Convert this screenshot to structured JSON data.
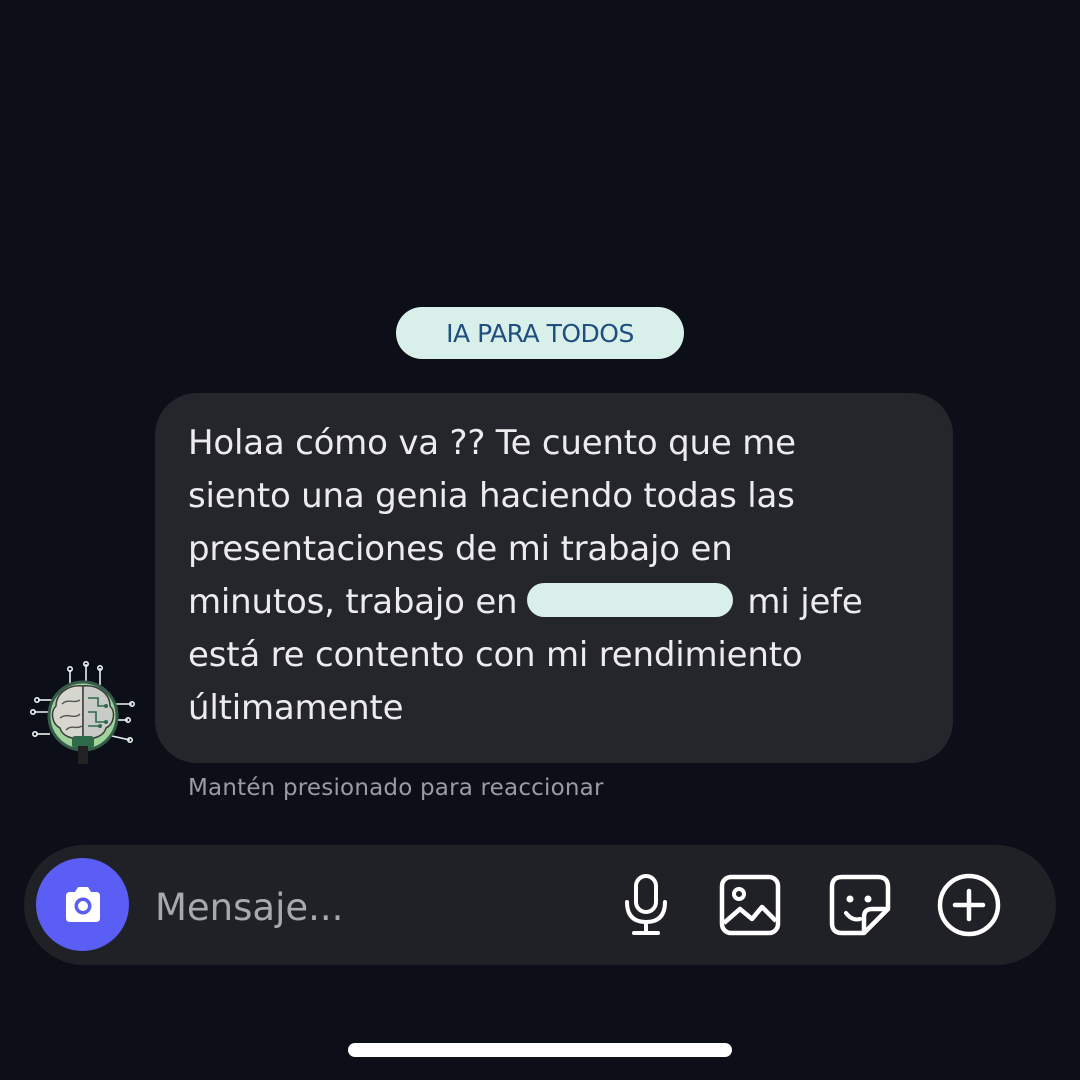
{
  "brand_tag": "IA PARA TODOS",
  "message": {
    "lines": [
      "Holaa cómo va ?? Te cuento que me",
      "siento una genia haciendo todas las",
      "presentaciones de mi trabajo en",
      "minutos, trabajo en",
      "mi jefe",
      "está re contento con mi rendimiento",
      "últimamente"
    ]
  },
  "reaction_hint": "Mantén presionado para reaccionar",
  "composer": {
    "placeholder": "Mensaje...",
    "icons": [
      "camera-icon",
      "microphone-icon",
      "gallery-icon",
      "sticker-icon",
      "plus-circle-icon"
    ]
  },
  "colors": {
    "background": "#0c0f17",
    "bubble": "#24262c",
    "accent_tag": "#d9efe9",
    "tag_text": "#1f4f80",
    "camera_button": "#5b5ef5"
  }
}
